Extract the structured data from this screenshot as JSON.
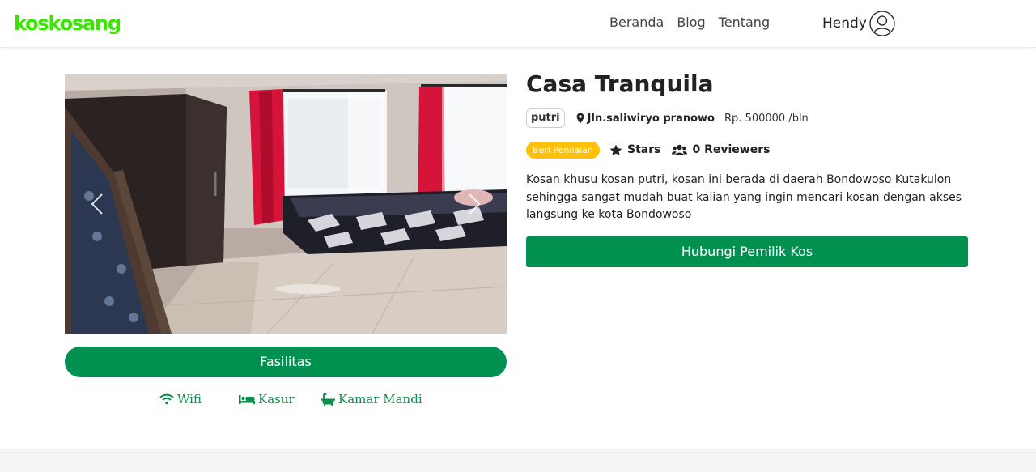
{
  "brand": {
    "logo_text": "koskosang",
    "logo_color": "#39e600"
  },
  "nav": {
    "links": [
      "Beranda",
      "Blog",
      "Tentang"
    ],
    "user_name": "Hendy",
    "user_icon": "user-circle-icon"
  },
  "gallery": {
    "prev_icon": "chevron-left-icon",
    "next_icon": "chevron-right-icon"
  },
  "facilities": {
    "button_label": "Fasilitas",
    "items": [
      {
        "label": "Wifi",
        "icon": "wifi-icon"
      },
      {
        "label": "Kasur",
        "icon": "bed-icon"
      },
      {
        "label": "Kamar Mandi",
        "icon": "bath-icon"
      }
    ]
  },
  "property": {
    "title": "Casa Tranquila",
    "type_badge": "putri",
    "location": "Jln.saliwiryo pranowo",
    "price": "Rp. 500000 /bln",
    "rate_button": "Beri Penilaian",
    "stars_label": "Stars",
    "reviewers_label": "0 Reviewers",
    "description": "Kosan khusu kosan putri, kosan ini berada di daerah Bondowoso Kutakulon sehingga sangat mudah buat kalian yang ingin mencari kosan dengan akses langsung ke kota Bondowoso",
    "contact_button": "Hubungi Pemilik Kos"
  },
  "colors": {
    "primary": "#009150",
    "accent_yellow": "#ffc107",
    "facility_text": "#0a8f4a"
  }
}
